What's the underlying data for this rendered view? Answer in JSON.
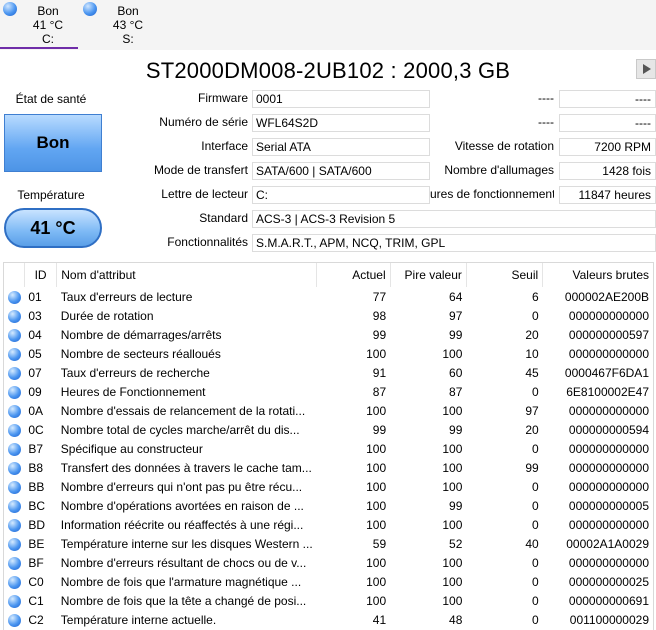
{
  "drives": [
    {
      "status": "Bon",
      "temp": "41 °C",
      "letter": "C:",
      "active": true
    },
    {
      "status": "Bon",
      "temp": "43 °C",
      "letter": "S:",
      "active": false
    }
  ],
  "title": "ST2000DM008-2UB102 : 2000,3 GB",
  "health": {
    "label": "État de santé",
    "value": "Bon",
    "color": "#62a6f2"
  },
  "temperature": {
    "label": "Température",
    "value": "41 °C"
  },
  "info": {
    "firmware": {
      "label": "Firmware",
      "value": "0001"
    },
    "serial": {
      "label": "Numéro de série",
      "value": "WFL64S2D"
    },
    "interface": {
      "label": "Interface",
      "value": "Serial ATA"
    },
    "transfer": {
      "label": "Mode de transfert",
      "value": "SATA/600 | SATA/600"
    },
    "drive_letter": {
      "label": "Lettre de lecteur",
      "value": "C:"
    },
    "standard": {
      "label": "Standard",
      "value": "ACS-3 | ACS-3 Revision 5"
    },
    "features": {
      "label": "Fonctionnalités",
      "value": "S.M.A.R.T., APM, NCQ, TRIM, GPL"
    },
    "right1": {
      "label": "----",
      "value": "----"
    },
    "right2": {
      "label": "----",
      "value": "----"
    },
    "rotation": {
      "label": "Vitesse de rotation",
      "value": "7200 RPM"
    },
    "power_count": {
      "label": "Nombre d'allumages",
      "value": "1428 fois"
    },
    "power_hours": {
      "label": "ures de fonctionnement",
      "value": "11847 heures"
    }
  },
  "table": {
    "headers": {
      "id": "ID",
      "name": "Nom d'attribut",
      "current": "Actuel",
      "worst": "Pire valeur",
      "threshold": "Seuil",
      "raw": "Valeurs brutes"
    },
    "rows": [
      {
        "id": "01",
        "name": "Taux d'erreurs de lecture",
        "current": "77",
        "worst": "64",
        "threshold": "6",
        "raw": "000002AE200B"
      },
      {
        "id": "03",
        "name": "Durée de rotation",
        "current": "98",
        "worst": "97",
        "threshold": "0",
        "raw": "000000000000"
      },
      {
        "id": "04",
        "name": "Nombre de démarrages/arrêts",
        "current": "99",
        "worst": "99",
        "threshold": "20",
        "raw": "000000000597"
      },
      {
        "id": "05",
        "name": "Nombre de secteurs réalloués",
        "current": "100",
        "worst": "100",
        "threshold": "10",
        "raw": "000000000000"
      },
      {
        "id": "07",
        "name": "Taux d'erreurs de recherche",
        "current": "91",
        "worst": "60",
        "threshold": "45",
        "raw": "0000467F6DA1"
      },
      {
        "id": "09",
        "name": "Heures de Fonctionnement",
        "current": "87",
        "worst": "87",
        "threshold": "0",
        "raw": "6E8100002E47"
      },
      {
        "id": "0A",
        "name": "Nombre d'essais de relancement de la rotati...",
        "current": "100",
        "worst": "100",
        "threshold": "97",
        "raw": "000000000000"
      },
      {
        "id": "0C",
        "name": "Nombre total de cycles marche/arrêt du dis...",
        "current": "99",
        "worst": "99",
        "threshold": "20",
        "raw": "000000000594"
      },
      {
        "id": "B7",
        "name": "Spécifique au constructeur",
        "current": "100",
        "worst": "100",
        "threshold": "0",
        "raw": "000000000000"
      },
      {
        "id": "B8",
        "name": "Transfert des données à travers le cache tam...",
        "current": "100",
        "worst": "100",
        "threshold": "99",
        "raw": "000000000000"
      },
      {
        "id": "BB",
        "name": "Nombre d'erreurs qui n'ont pas pu être récu...",
        "current": "100",
        "worst": "100",
        "threshold": "0",
        "raw": "000000000000"
      },
      {
        "id": "BC",
        "name": "Nombre d'opérations avortées en raison de ...",
        "current": "100",
        "worst": "99",
        "threshold": "0",
        "raw": "000000000005"
      },
      {
        "id": "BD",
        "name": "Information réécrite ou réaffectés à une régi...",
        "current": "100",
        "worst": "100",
        "threshold": "0",
        "raw": "000000000000"
      },
      {
        "id": "BE",
        "name": "Température interne sur les disques Western ...",
        "current": "59",
        "worst": "52",
        "threshold": "40",
        "raw": "00002A1A0029"
      },
      {
        "id": "BF",
        "name": "Nombre d'erreurs résultant de chocs ou de v...",
        "current": "100",
        "worst": "100",
        "threshold": "0",
        "raw": "000000000000"
      },
      {
        "id": "C0",
        "name": "Nombre de fois que l'armature magnétique ...",
        "current": "100",
        "worst": "100",
        "threshold": "0",
        "raw": "000000000025"
      },
      {
        "id": "C1",
        "name": "Nombre de fois que la tête a changé de posi...",
        "current": "100",
        "worst": "100",
        "threshold": "0",
        "raw": "000000000691"
      },
      {
        "id": "C2",
        "name": "Température interne actuelle.",
        "current": "41",
        "worst": "48",
        "threshold": "0",
        "raw": "001100000029"
      }
    ]
  }
}
